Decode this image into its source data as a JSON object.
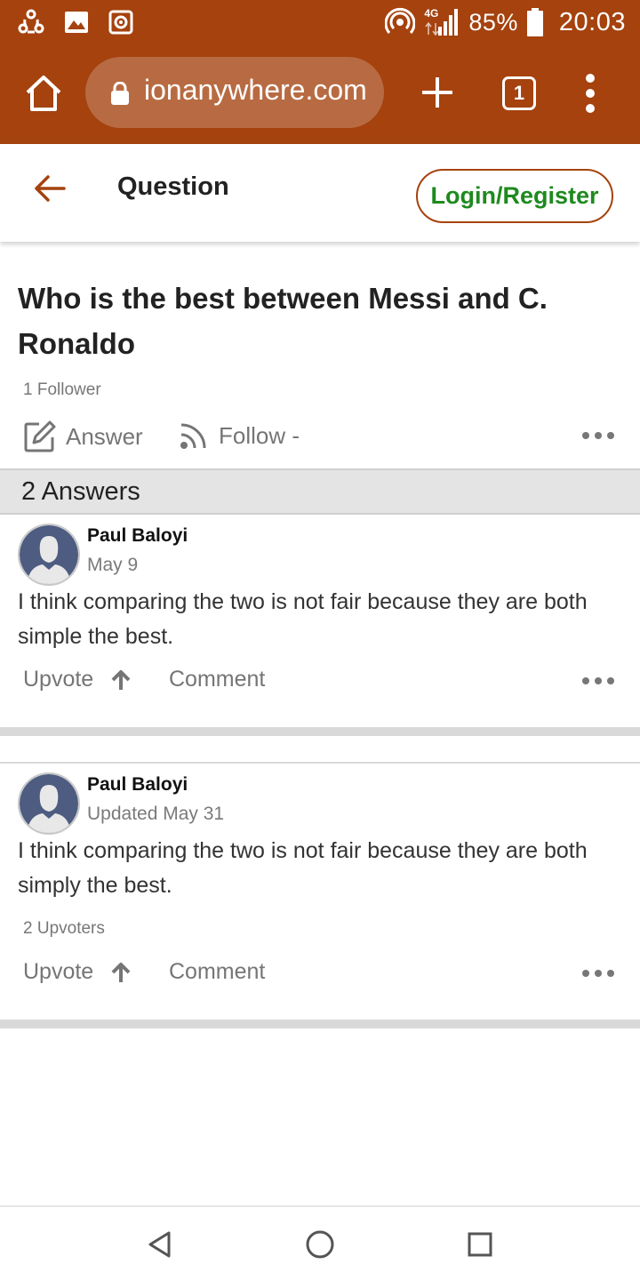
{
  "status_bar": {
    "network": "4G",
    "battery": "85%",
    "time": "20:03",
    "icons": [
      "share-icon",
      "image-icon",
      "screenshot-icon",
      "hotspot-icon",
      "signal-icon",
      "battery-icon"
    ]
  },
  "browser": {
    "url": "ionanywhere.com",
    "tab_count": "1",
    "icons": [
      "home-icon",
      "lock-icon",
      "plus-icon",
      "kebab-menu-icon"
    ]
  },
  "header": {
    "title": "Question",
    "login_label": "Login/Register",
    "accent_color": "#a5420e",
    "login_text_color": "#1e8a1e"
  },
  "question": {
    "title": "Who is the best between Messi and C. Ronaldo",
    "followers": "1 Follower",
    "answer_label": "Answer",
    "follow_label": "Follow -"
  },
  "answers_header": "2 Answers",
  "answers": [
    {
      "author": "Paul Baloyi",
      "date": "May 9",
      "text": "I think comparing the two is not fair because they are both simple the best.",
      "upvoters": "",
      "upvote_label": "Upvote",
      "comment_label": "Comment"
    },
    {
      "author": "Paul Baloyi",
      "date": "Updated May 31",
      "text": "I think comparing the two is not fair because they are both simply the best.",
      "upvoters": "2 Upvoters",
      "upvote_label": "Upvote",
      "comment_label": "Comment"
    }
  ],
  "nav": {
    "icons": [
      "back-triangle-icon",
      "home-circle-icon",
      "recents-square-icon"
    ]
  }
}
